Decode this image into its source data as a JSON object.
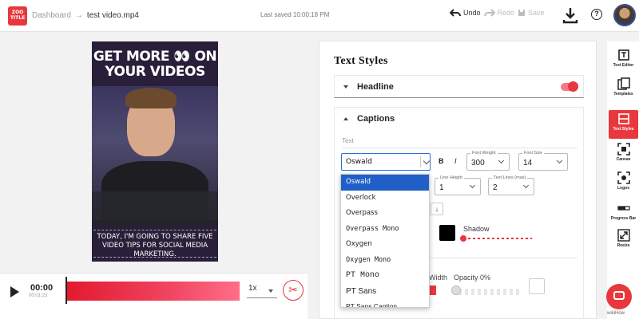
{
  "topbar": {
    "logo_line1": "ZOO",
    "logo_line2": "TITLE",
    "breadcrumb_root": "Dashboard",
    "breadcrumb_sep": "→",
    "filename": "test video.mp4",
    "last_saved": "Last saved 10:00:18 PM",
    "undo": "Undo",
    "redo": "Redo",
    "save": "Save",
    "help": "?"
  },
  "video": {
    "title_line1": "GET MORE 👀 ON",
    "title_line2": "YOUR VIDEOS",
    "caption": "TODAY, I'M GOING TO SHARE FIVE VIDEO TIPS FOR SOCIAL MEDIA MARKETING."
  },
  "player": {
    "current_time": "00:00",
    "total_time": "00:01:23",
    "speed": "1x"
  },
  "panel": {
    "title": "Text Styles",
    "headline_label": "Headline",
    "headline_enabled": true,
    "captions_label": "Captions",
    "text_sub_label": "Text",
    "font_family": "Oswald",
    "bold": "B",
    "italic": "I",
    "font_weight_label": "Font Weight",
    "font_weight": "300",
    "font_size_label": "Font Size",
    "font_size": "14",
    "line_height_label": "Line Height",
    "line_height": "1",
    "text_lines_label": "Text Lines (max)",
    "text_lines": "2",
    "align_icon": "↓",
    "shadow_label": "Shadow",
    "width_label": "Width",
    "opacity_label": "Opacity 0%",
    "text_color": "#000000",
    "accent_color": "#e8383d"
  },
  "font_dropdown": {
    "options": [
      "Oswald",
      "Overlock",
      "Overpass",
      "Overpass Mono",
      "Oxygen",
      "Oxygen Mono",
      "PT Mono",
      "PT Sans",
      "PT Sans Caption"
    ],
    "selected": "Oswald"
  },
  "sidebar": {
    "items": [
      {
        "label": "Text Editor",
        "icon": "text-editor-icon"
      },
      {
        "label": "Templates",
        "icon": "templates-icon"
      },
      {
        "label": "Text Styles",
        "icon": "text-styles-icon",
        "active": true
      },
      {
        "label": "Canvas",
        "icon": "canvas-icon"
      },
      {
        "label": "Logos",
        "icon": "logos-icon"
      },
      {
        "label": "Progress Bar",
        "icon": "progress-bar-icon"
      },
      {
        "label": "Resize",
        "icon": "resize-icon"
      }
    ]
  },
  "watermark": "wikiHow"
}
